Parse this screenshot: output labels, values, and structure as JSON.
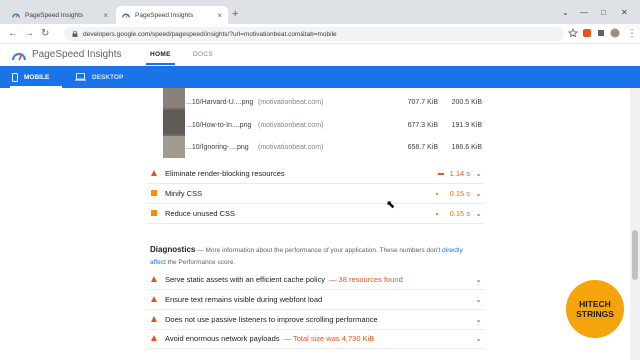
{
  "browser": {
    "tabs": [
      {
        "title": "PageSpeed Insights",
        "active": false
      },
      {
        "title": "PageSpeed Insights",
        "active": true
      }
    ],
    "url": "developers.google.com/speed/pagespeed/insights/?url=motivationbeat.com&tab=mobile"
  },
  "psi": {
    "title": "PageSpeed Insights",
    "nav_home": "HOME",
    "nav_docs": "DOCS",
    "tab_mobile": "MOBILE",
    "tab_desktop": "DESKTOP"
  },
  "images": [
    {
      "name": "...10/Harvard-U....png",
      "origin": "(motivationbeat.com)",
      "size": "707.7 KiB",
      "savings": "200.5 KiB"
    },
    {
      "name": "...10/How-to-In....png",
      "origin": "(motivationbeat.com)",
      "size": "677.3 KiB",
      "savings": "191.9 KiB"
    },
    {
      "name": "...10/Ignoring-....png",
      "origin": "(motivationbeat.com)",
      "size": "658.7 KiB",
      "savings": "186.6 KiB"
    }
  ],
  "opportunities": [
    {
      "label": "Eliminate render-blocking resources",
      "value": "1.14 s",
      "severity": "red"
    },
    {
      "label": "Minify CSS",
      "value": "0.15 s",
      "severity": "orange"
    },
    {
      "label": "Reduce unused CSS",
      "value": "0.15 s",
      "severity": "orange"
    }
  ],
  "diagnostics": {
    "title": "Diagnostics",
    "desc_prefix": " — More information about the performance of your application. These numbers don't ",
    "desc_link": "directly affect",
    "desc_suffix": " the Performance score.",
    "items": [
      {
        "label": "Serve static assets with an efficient cache policy",
        "extra": "— 38 resources found"
      },
      {
        "label": "Ensure text remains visible during webfont load",
        "extra": ""
      },
      {
        "label": "Does not use passive listeners to improve scrolling performance",
        "extra": ""
      },
      {
        "label": "Avoid enormous network payloads",
        "extra": "— Total size was 4,730 KiB"
      }
    ]
  },
  "badge": {
    "line1": "HITECH",
    "line2": "STRINGS"
  },
  "colors": {
    "accent": "#1a73e8",
    "fail": "#e8541a",
    "average": "#fb8c00"
  }
}
